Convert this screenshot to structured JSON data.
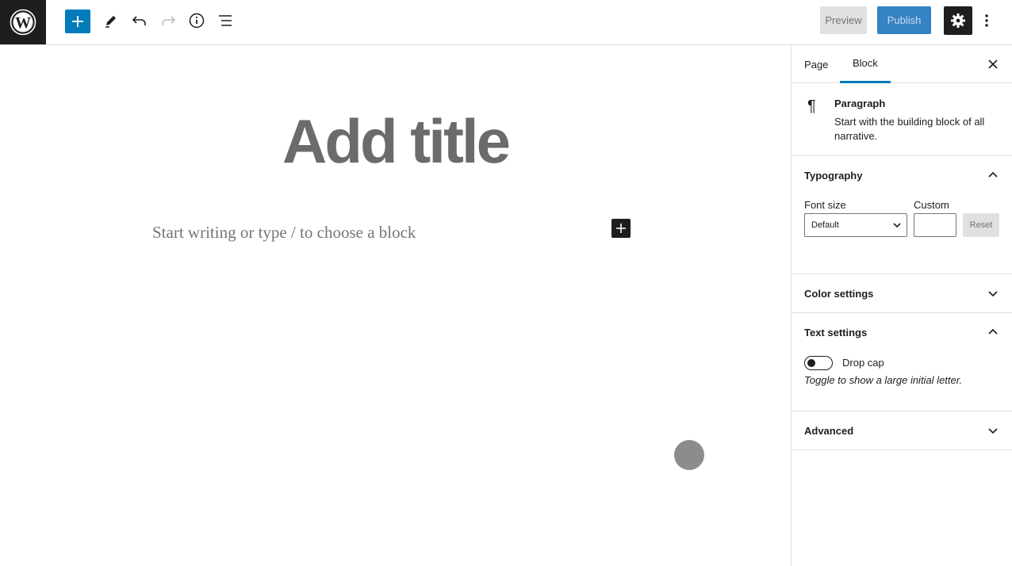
{
  "toolbar": {
    "logo_icon": "wordpress-icon",
    "buttons": [
      {
        "name": "add-block-button",
        "icon": "plus-icon"
      },
      {
        "name": "tools-button",
        "icon": "pencil-icon"
      },
      {
        "name": "undo-button",
        "icon": "undo-icon"
      },
      {
        "name": "redo-button",
        "icon": "redo-icon"
      },
      {
        "name": "details-button",
        "icon": "info-icon"
      },
      {
        "name": "list-view-button",
        "icon": "list-view-icon"
      }
    ],
    "preview_label": "Preview",
    "publish_label": "Publish",
    "settings_icon": "gear-icon",
    "more_icon": "more-vertical-icon",
    "accent_color": "#007cba"
  },
  "editor": {
    "title_placeholder": "Add title",
    "paragraph_placeholder": "Start writing or type / to choose a block"
  },
  "sidebar": {
    "tabs": [
      {
        "label": "Page",
        "active": false
      },
      {
        "label": "Block",
        "active": true
      }
    ],
    "block": {
      "name": "Paragraph",
      "description": "Start with the building block of all narrative.",
      "icon": "paragraph-icon"
    },
    "typography": {
      "title": "Typography",
      "expanded": true,
      "font_size_label": "Font size",
      "font_size_value": "Default",
      "custom_label": "Custom",
      "custom_value": "",
      "reset_label": "Reset"
    },
    "color_settings": {
      "title": "Color settings",
      "expanded": false
    },
    "text_settings": {
      "title": "Text settings",
      "expanded": true,
      "drop_cap_label": "Drop cap",
      "drop_cap_on": false,
      "help": "Toggle to show a large initial letter."
    },
    "advanced": {
      "title": "Advanced",
      "expanded": false
    }
  }
}
